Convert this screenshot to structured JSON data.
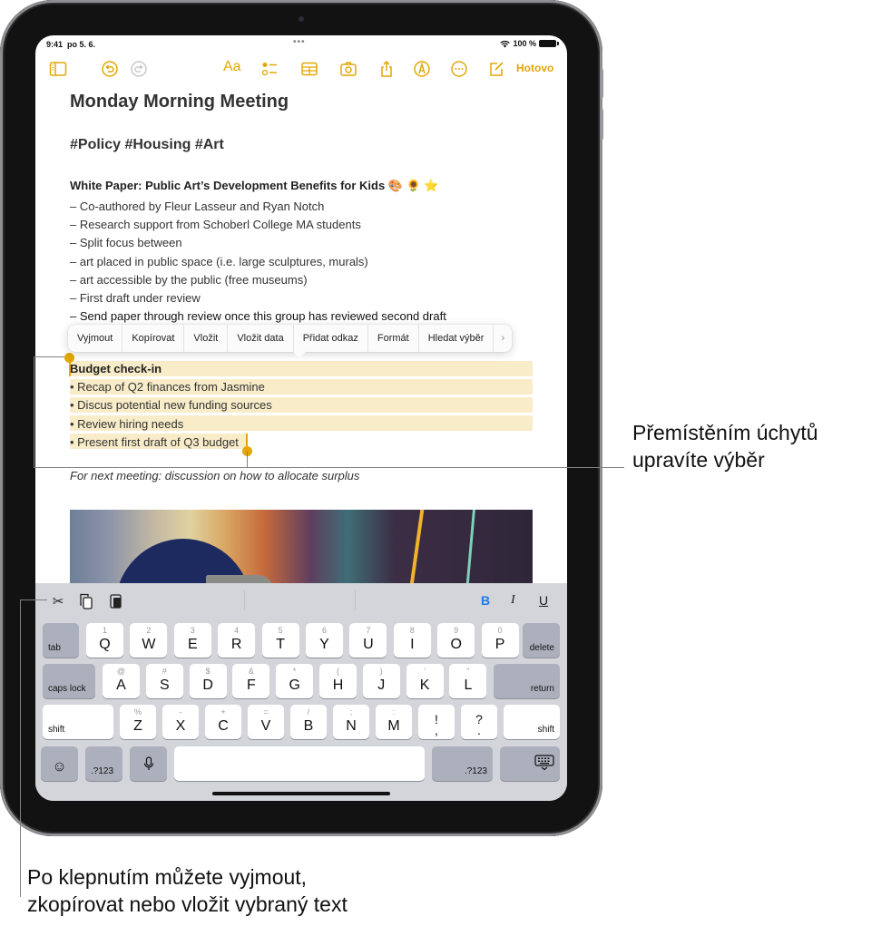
{
  "status_bar": {
    "time": "9:41",
    "date": "po 5. 6.",
    "dots": "•••",
    "battery_percent": "100 %",
    "wifi_icon": "wifi-icon",
    "battery_icon": "battery-icon"
  },
  "toolbar": {
    "icons_left": [
      "sidebar-icon",
      "undo-icon",
      "redo-icon"
    ],
    "format_label": "Aa",
    "icons_right": [
      "checklist-icon",
      "table-icon",
      "camera-icon",
      "share-icon",
      "markup-icon",
      "more-icon",
      "compose-icon"
    ],
    "done_label": "Hotovo",
    "accent_color": "#e3a606"
  },
  "note": {
    "title": "Monday Morning Meeting",
    "tags": "#Policy #Housing #Art",
    "subheading": "White Paper: Public Art’s Development Benefits for Kids 🎨 🌻 ⭐",
    "lines": [
      "– Co-authored by Fleur Lasseur and Ryan Notch",
      "– Research support from Schoberl College MA students",
      "– Split focus between",
      "– art placed in public space (i.e. large sculptures, murals)",
      "– art accessible by the public (free museums)",
      "– First draft under review",
      "– Send paper through review once this group has reviewed second draft"
    ],
    "selected": {
      "heading": "Budget check-in",
      "items": [
        "• Recap of Q2 finances from Jasmine",
        "• Discus potential new funding sources",
        "• Review hiring needs",
        "• Present first draft of Q3 budget"
      ],
      "highlight_color": "#f8ecc9"
    },
    "italic_line": "For next meeting: discussion on how to allocate surplus"
  },
  "edit_menu": {
    "items": [
      "Vyjmout",
      "Kopírovat",
      "Vložit",
      "Vložit data",
      "Přidat odkaz",
      "Formát",
      "Hledat výběr"
    ],
    "more_label": "›"
  },
  "keyboard_toolbar": {
    "cut_icon": "✂",
    "copy_icon": "copy-icon",
    "paste_icon": "paste-icon",
    "bold_label": "B",
    "italic_label": "I",
    "underline_label": "U",
    "bold_color": "#1a7cf5"
  },
  "keyboard": {
    "row1": [
      {
        "main": "Q",
        "alt": "1"
      },
      {
        "main": "W",
        "alt": "2"
      },
      {
        "main": "E",
        "alt": "3"
      },
      {
        "main": "R",
        "alt": "4"
      },
      {
        "main": "T",
        "alt": "5"
      },
      {
        "main": "Y",
        "alt": "6"
      },
      {
        "main": "U",
        "alt": "7"
      },
      {
        "main": "I",
        "alt": "8"
      },
      {
        "main": "O",
        "alt": "9"
      },
      {
        "main": "P",
        "alt": "0"
      }
    ],
    "row2": [
      {
        "main": "A",
        "alt": "@"
      },
      {
        "main": "S",
        "alt": "#"
      },
      {
        "main": "D",
        "alt": "$"
      },
      {
        "main": "F",
        "alt": "&"
      },
      {
        "main": "G",
        "alt": "*"
      },
      {
        "main": "H",
        "alt": "("
      },
      {
        "main": "J",
        "alt": ")"
      },
      {
        "main": "K",
        "alt": "’"
      },
      {
        "main": "L",
        "alt": "\""
      }
    ],
    "row3": [
      {
        "main": "Z",
        "alt": "%"
      },
      {
        "main": "X",
        "alt": "-"
      },
      {
        "main": "C",
        "alt": "+"
      },
      {
        "main": "V",
        "alt": "="
      },
      {
        "main": "B",
        "alt": "/"
      },
      {
        "main": "N",
        "alt": ";"
      },
      {
        "main": "M",
        "alt": ":"
      },
      {
        "main": "!\n,",
        "alt": ""
      },
      {
        "main": "?\n.",
        "alt": ""
      }
    ],
    "tab_label": "tab",
    "delete_label": "delete",
    "caps_label": "caps lock",
    "return_label": "return",
    "shift_label": "shift",
    "numbers_label": ".?123",
    "emoji_icon": "☺",
    "mic_icon": "🎙",
    "hide_keyboard_icon": "⌨"
  },
  "callouts": {
    "handles": "Přemístěním úchytů\nupravíte výběr",
    "handles_line1": "Přemístěním úchytů",
    "handles_line2": "upravíte výběr",
    "edit_line1": "Po klepnutím můžete vyjmout,",
    "edit_line2": "zkopírovat nebo vložit vybraný text"
  }
}
